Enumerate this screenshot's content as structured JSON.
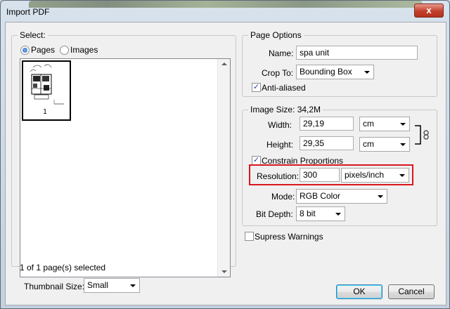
{
  "window": {
    "title": "Import PDF",
    "close_glyph": "x"
  },
  "select_group": {
    "legend": "Select:",
    "radio_pages_label": "Pages",
    "radio_images_label": "Images",
    "selected_radio": "Pages",
    "thumbnails": [
      {
        "page_label": "1"
      }
    ],
    "status": "1 of 1 page(s) selected",
    "thumbnail_size_label": "Thumbnail Size:",
    "thumbnail_size_value": "Small"
  },
  "page_options": {
    "legend": "Page Options",
    "name_label": "Name:",
    "name_value": "spa unit",
    "crop_label": "Crop To:",
    "crop_value": "Bounding Box",
    "anti_aliased_label": "Anti-aliased",
    "anti_aliased_checked": true
  },
  "image_size": {
    "legend": "Image Size: 34,2M",
    "width_label": "Width:",
    "width_value": "29,19",
    "width_unit": "cm",
    "height_label": "Height:",
    "height_value": "29,35",
    "height_unit": "cm",
    "constrain_label": "Constrain Proportions",
    "constrain_checked": true,
    "resolution_label": "Resolution:",
    "resolution_value": "300",
    "resolution_unit": "pixels/inch",
    "mode_label": "Mode:",
    "mode_value": "RGB Color",
    "bit_depth_label": "Bit Depth:",
    "bit_depth_value": "8 bit"
  },
  "supress_warnings": {
    "label": "Supress Warnings",
    "checked": false
  },
  "buttons": {
    "ok": "OK",
    "cancel": "Cancel"
  },
  "colors": {
    "highlight": "#d9171e",
    "close_button": "#c2402b"
  }
}
